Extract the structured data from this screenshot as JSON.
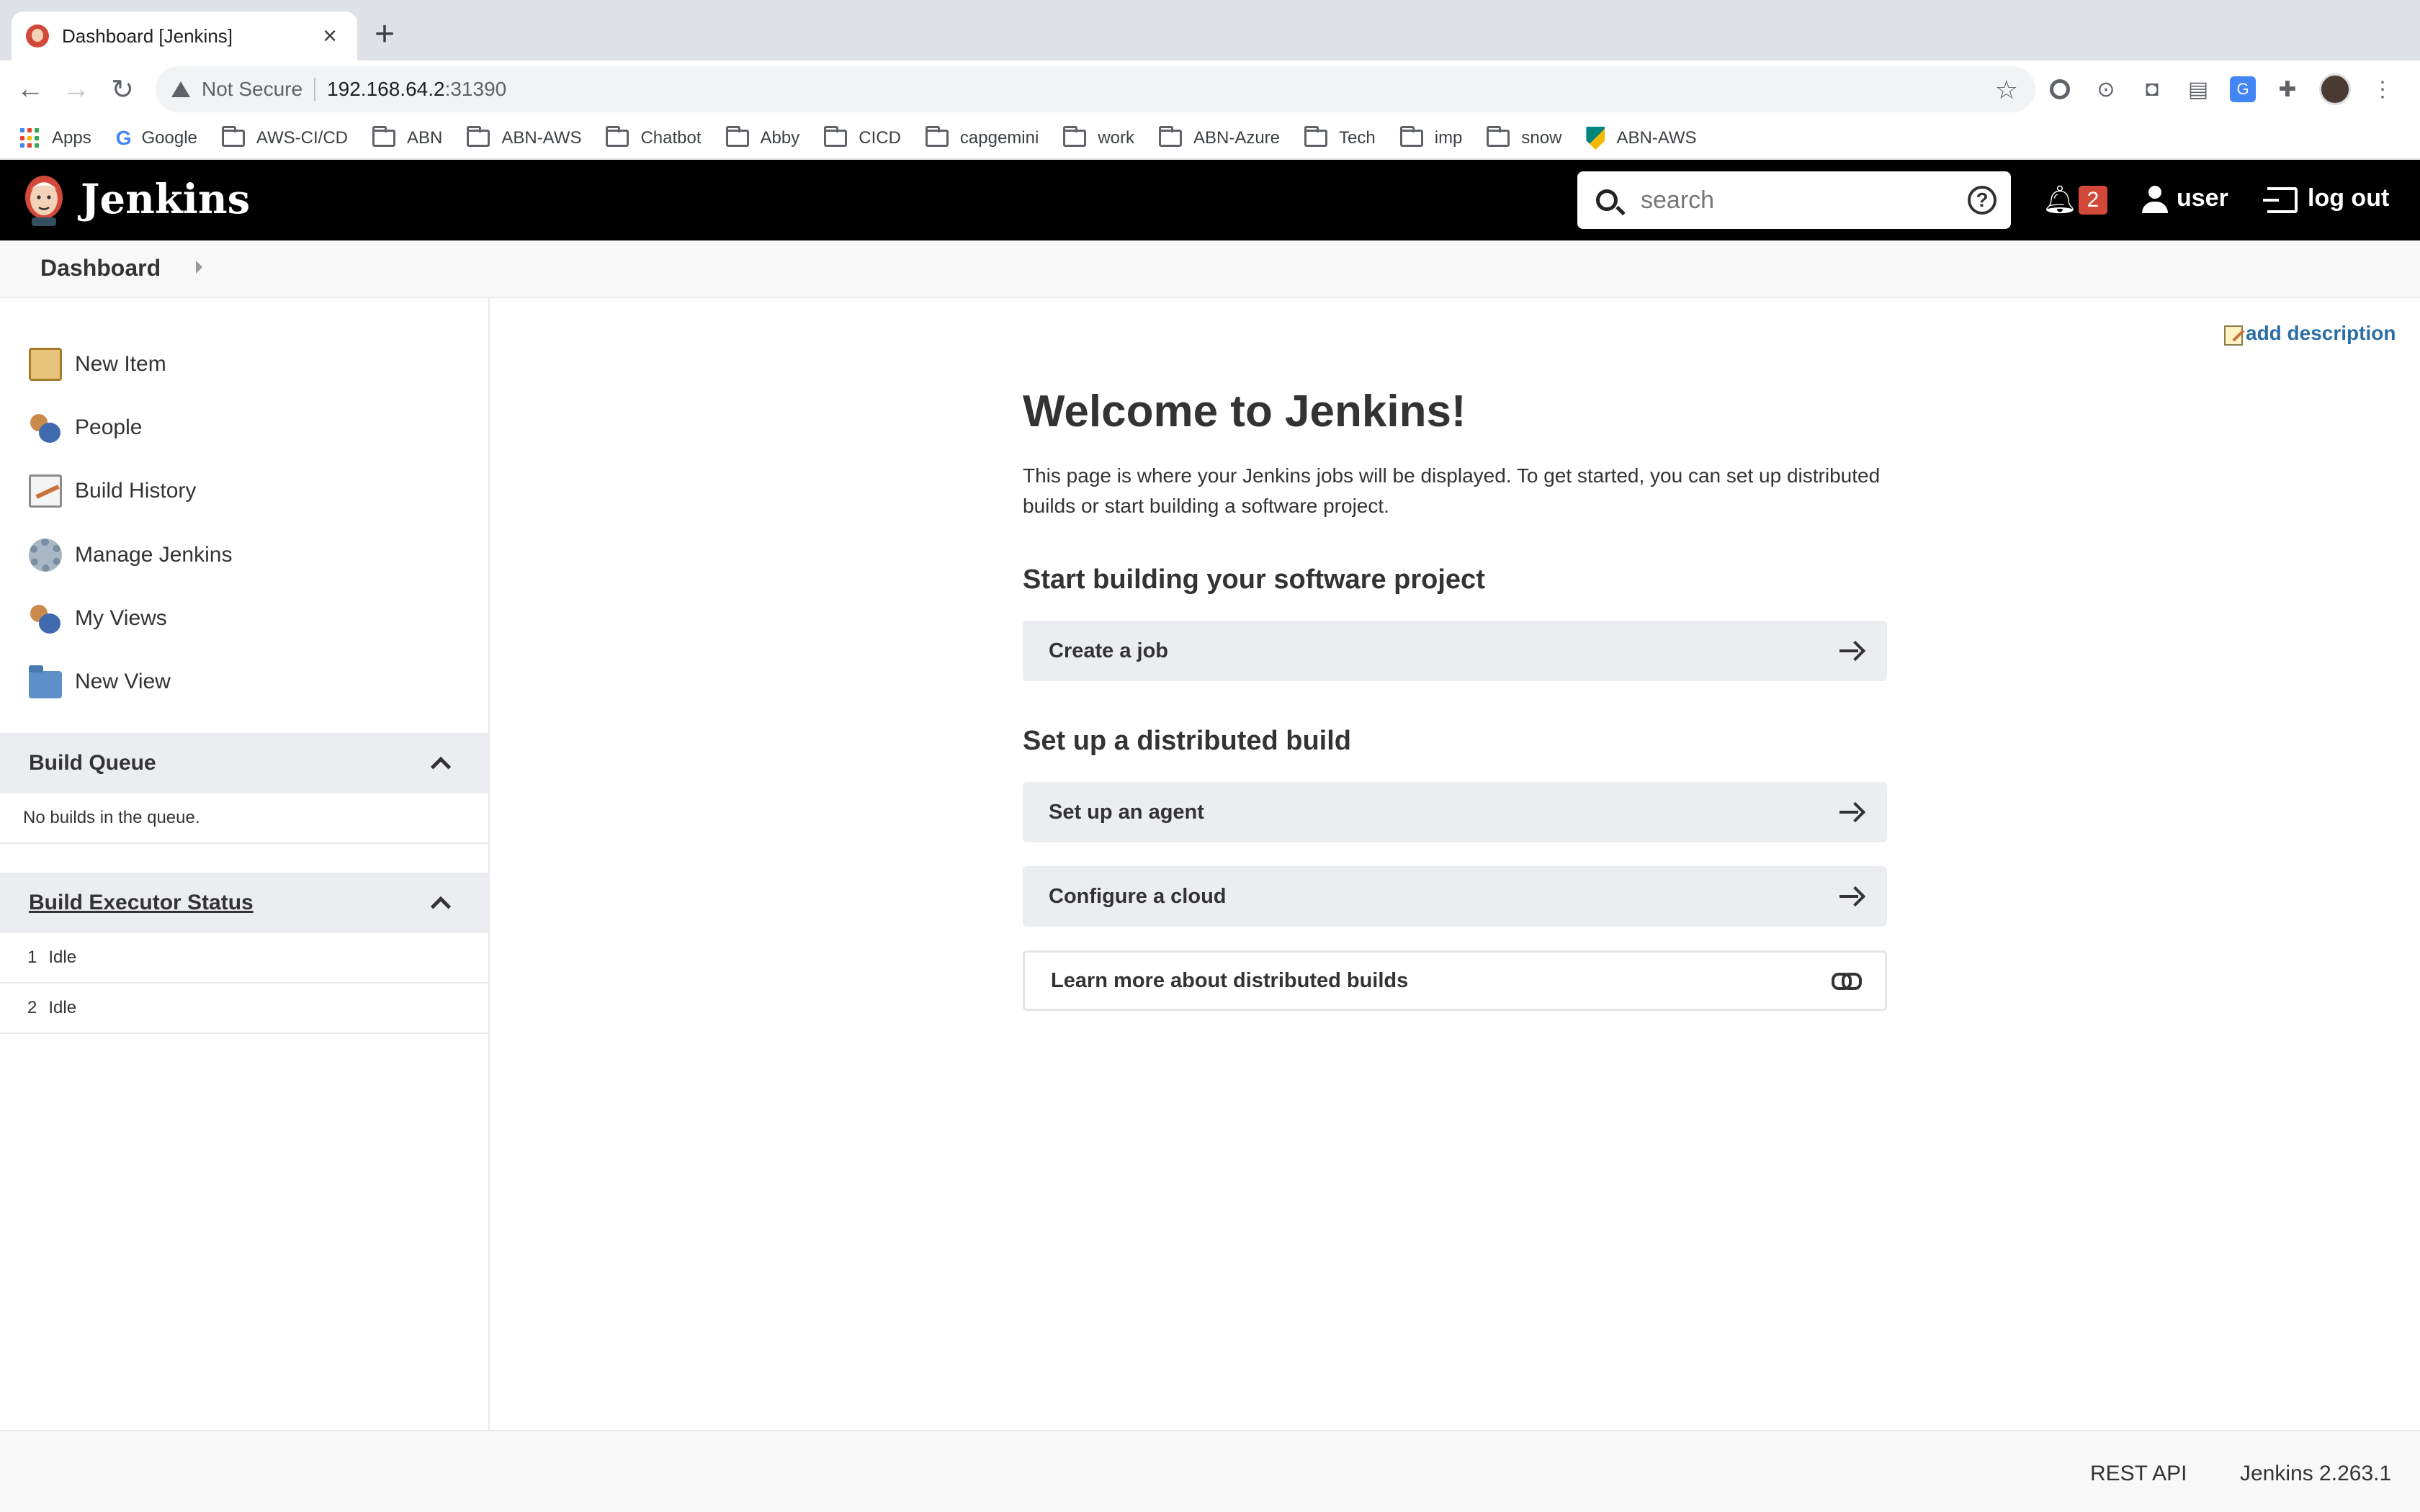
{
  "browser": {
    "tab_title": "Dashboard [Jenkins]",
    "security_label": "Not Secure",
    "url_host": "192.168.64.2",
    "url_port": ":31390",
    "bookmarks": [
      {
        "label": "Apps",
        "icon": "apps-grid-icon"
      },
      {
        "label": "Google",
        "icon": "google-icon"
      },
      {
        "label": "AWS-CI/CD",
        "icon": "folder-icon"
      },
      {
        "label": "ABN",
        "icon": "folder-icon"
      },
      {
        "label": "ABN-AWS",
        "icon": "folder-icon"
      },
      {
        "label": "Chatbot",
        "icon": "folder-icon"
      },
      {
        "label": "Abby",
        "icon": "folder-icon"
      },
      {
        "label": "CICD",
        "icon": "folder-icon"
      },
      {
        "label": "capgemini",
        "icon": "folder-icon"
      },
      {
        "label": "work",
        "icon": "folder-icon"
      },
      {
        "label": "ABN-Azure",
        "icon": "folder-icon"
      },
      {
        "label": "Tech",
        "icon": "folder-icon"
      },
      {
        "label": "imp",
        "icon": "folder-icon"
      },
      {
        "label": "snow",
        "icon": "folder-icon"
      },
      {
        "label": "ABN-AWS",
        "icon": "abn-logo-icon"
      }
    ]
  },
  "header": {
    "brand": "Jenkins",
    "search_placeholder": "search",
    "notification_count": "2",
    "user": "user",
    "logout": "log out"
  },
  "breadcrumb": {
    "items": [
      "Dashboard"
    ]
  },
  "sidebar": {
    "tasks": [
      {
        "label": "New Item",
        "icon": "new-item-icon"
      },
      {
        "label": "People",
        "icon": "people-icon"
      },
      {
        "label": "Build History",
        "icon": "build-history-icon"
      },
      {
        "label": "Manage Jenkins",
        "icon": "gear-icon"
      },
      {
        "label": "My Views",
        "icon": "my-views-icon"
      },
      {
        "label": "New View",
        "icon": "folder-icon"
      }
    ],
    "build_queue": {
      "title": "Build Queue",
      "empty_text": "No builds in the queue."
    },
    "executor_status": {
      "title": "Build Executor Status",
      "executors": [
        {
          "number": "1",
          "status": "Idle"
        },
        {
          "number": "2",
          "status": "Idle"
        }
      ]
    }
  },
  "main": {
    "add_description": "add description",
    "welcome_title": "Welcome to Jenkins!",
    "intro_text": "This page is where your Jenkins jobs will be displayed. To get started, you can set up distributed builds or start building a software project.",
    "section_start": "Start building your software project",
    "create_job": "Create a job",
    "section_distributed": "Set up a distributed build",
    "setup_agent": "Set up an agent",
    "configure_cloud": "Configure a cloud",
    "learn_more": "Learn more about distributed builds"
  },
  "footer": {
    "rest_api": "REST API",
    "version": "Jenkins 2.263.1"
  },
  "colors": {
    "header_bg": "#000000",
    "badge": "#d24939",
    "link": "#2b6ea4",
    "pane_header_bg": "#ebedf0"
  }
}
